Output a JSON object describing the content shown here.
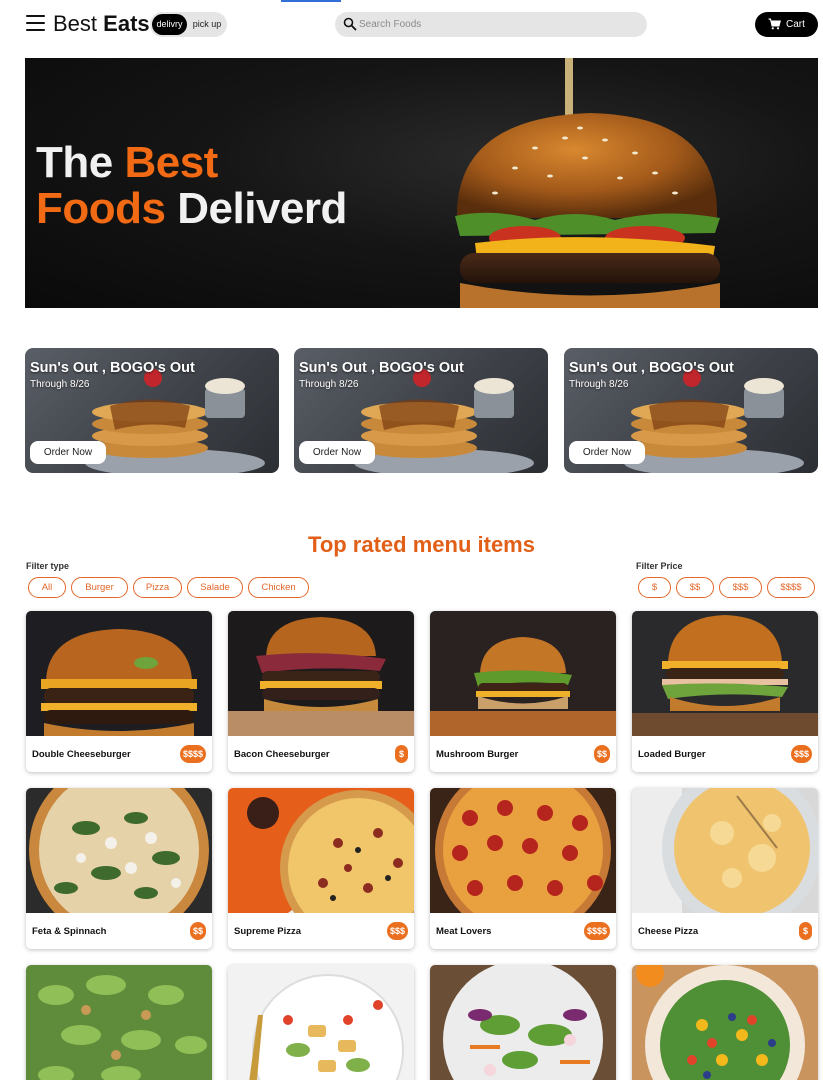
{
  "header": {
    "brand_regular": "Best",
    "brand_bold": "Eats",
    "mode_active": "delivry",
    "mode_inactive": "pick up",
    "search_placeholder": "Search Foods",
    "cart_label": "Cart"
  },
  "hero": {
    "line1_plain": "The",
    "line1_accent": "Best",
    "line2_accent": "Foods",
    "line2_plain": "Deliverd"
  },
  "promos": [
    {
      "title": "Sun's Out , BOGO's Out",
      "subtitle": "Through 8/26",
      "button": "Order Now"
    },
    {
      "title": "Sun's Out , BOGO's Out",
      "subtitle": "Through 8/26",
      "button": "Order Now"
    },
    {
      "title": "Sun's Out , BOGO's Out",
      "subtitle": "Through 8/26",
      "button": "Order Now"
    }
  ],
  "menu": {
    "title": "Top rated menu items",
    "filter_type_label": "Filter type",
    "filter_types": [
      "All",
      "Burger",
      "Pizza",
      "Salade",
      "Chicken"
    ],
    "filter_price_label": "Filter Price",
    "filter_prices": [
      "$",
      "$$",
      "$$$",
      "$$$$"
    ],
    "items": [
      {
        "name": "Double Cheeseburger",
        "price": "$$$$",
        "icon": "burger-photo"
      },
      {
        "name": "Bacon Cheeseburger",
        "price": "$",
        "icon": "burger-photo"
      },
      {
        "name": "Mushroom Burger",
        "price": "$$",
        "icon": "burger-photo"
      },
      {
        "name": "Loaded Burger",
        "price": "$$$",
        "icon": "burger-photo"
      },
      {
        "name": "Feta & Spinnach",
        "price": "$$",
        "icon": "pizza-photo"
      },
      {
        "name": "Supreme Pizza",
        "price": "$$$",
        "icon": "pizza-photo"
      },
      {
        "name": "Meat Lovers",
        "price": "$$$$",
        "icon": "pizza-photo"
      },
      {
        "name": "Cheese Pizza",
        "price": "$",
        "icon": "pizza-photo"
      },
      {
        "name": "",
        "price": "",
        "icon": "salad-photo"
      },
      {
        "name": "",
        "price": "",
        "icon": "salad-photo"
      },
      {
        "name": "",
        "price": "",
        "icon": "salad-photo"
      },
      {
        "name": "",
        "price": "",
        "icon": "salad-photo"
      }
    ]
  },
  "colors": {
    "accent": "#e25f18",
    "price_badge": "#ea6f1f",
    "dark": "#000000"
  }
}
